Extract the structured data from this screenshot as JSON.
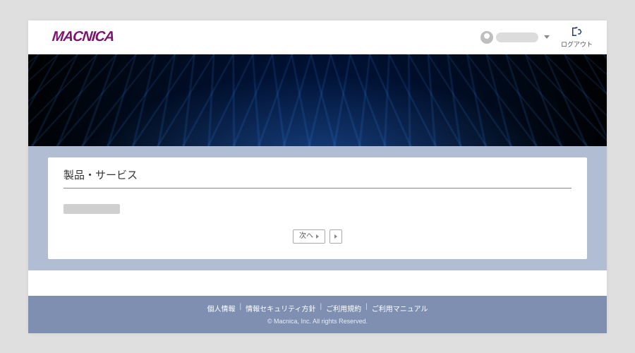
{
  "header": {
    "logo_text": "MACNICA",
    "logout_label": "ログアウト"
  },
  "card": {
    "title": "製品・サービス",
    "pager_next": "次へ"
  },
  "footer": {
    "links": [
      "個人情報",
      "情報セキュリティ方針",
      "ご利用規約",
      "ご利用マニュアル"
    ],
    "sep": "|",
    "copyright": "© Macnica, Inc. All rights Reserved."
  }
}
